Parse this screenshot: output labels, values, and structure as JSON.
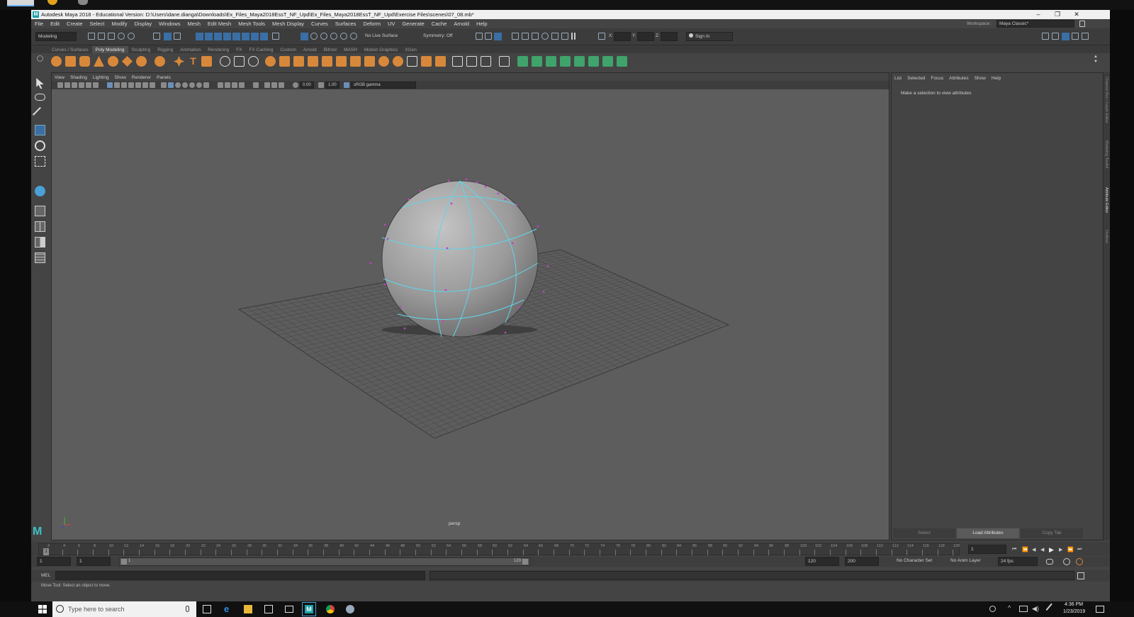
{
  "window": {
    "title": "Autodesk Maya 2018 - Educational Version: D:\\Users\\dane.dianga\\Downloads\\Ex_Files_Maya2018EssT_NF_Upd\\Ex_Files_Maya2018EssT_NF_Upd\\Exercise Files\\scenes\\07_08.mb*"
  },
  "menubar": {
    "items": [
      "File",
      "Edit",
      "Create",
      "Select",
      "Modify",
      "Display",
      "Windows",
      "Mesh",
      "Edit Mesh",
      "Mesh Tools",
      "Mesh Display",
      "Curves",
      "Surfaces",
      "Deform",
      "UV",
      "Generate",
      "Cache",
      "Arnold",
      "Help"
    ],
    "workspace_label": "Workspace :",
    "workspace_value": "Maya Classic*"
  },
  "statusline": {
    "mode": "Modeling",
    "live_surface": "No Live Surface",
    "symmetry": "Symmetry: Off",
    "x_label": "X:",
    "y_label": "Y:",
    "z_label": "Z:",
    "sign_in": "Sign In"
  },
  "shelf": {
    "tabs": [
      "Curves / Surfaces",
      "Poly Modeling",
      "Sculpting",
      "Rigging",
      "Animation",
      "Rendering",
      "FX",
      "FX Caching",
      "Custom",
      "Arnold",
      "Bifrost",
      "MASH",
      "Motion Graphics",
      "XGen"
    ],
    "active_tab": "Poly Modeling"
  },
  "viewport": {
    "menu": [
      "View",
      "Shading",
      "Lighting",
      "Show",
      "Renderer",
      "Panels"
    ],
    "exposure": "0.00",
    "gamma": "1.00",
    "color_space": "sRGB gamma",
    "camera_label": "persp"
  },
  "attribute_editor": {
    "menu": [
      "List",
      "Selected",
      "Focus",
      "Attributes",
      "Show",
      "Help"
    ],
    "message": "Make a selection to view attributes",
    "buttons": [
      "Select",
      "Load Attributes",
      "Copy Tab"
    ],
    "side_tabs": [
      "Channel Box / Layer Editor",
      "Modeling Toolkit",
      "Attribute Editor",
      "Outliner"
    ]
  },
  "timeline": {
    "ticks": [
      "2",
      "4",
      "6",
      "8",
      "10",
      "12",
      "14",
      "16",
      "18",
      "20",
      "22",
      "24",
      "26",
      "28",
      "30",
      "32",
      "34",
      "36",
      "38",
      "40",
      "42",
      "44",
      "46",
      "48",
      "50",
      "52",
      "54",
      "56",
      "58",
      "60",
      "62",
      "64",
      "66",
      "68",
      "70",
      "72",
      "74",
      "76",
      "78",
      "80",
      "82",
      "84",
      "86",
      "88",
      "90",
      "92",
      "94",
      "96",
      "98",
      "100",
      "102",
      "104",
      "106",
      "108",
      "110",
      "112",
      "114",
      "116",
      "118",
      "120"
    ],
    "current_frame": "1",
    "current_frame_box": "1",
    "range_start_a": "1",
    "range_start_b": "1",
    "range_bar_start": "1",
    "range_bar_end": "120",
    "range_end": "120",
    "anim_end": "200",
    "character_set": "No Character Set",
    "anim_layer": "No Anim Layer",
    "fps": "24 fps"
  },
  "command": {
    "language": "MEL",
    "help_text": "Move Tool: Select an object to move."
  },
  "taskbar": {
    "search_placeholder": "Type here to search",
    "time": "4:36 PM",
    "date": "1/23/2019"
  }
}
